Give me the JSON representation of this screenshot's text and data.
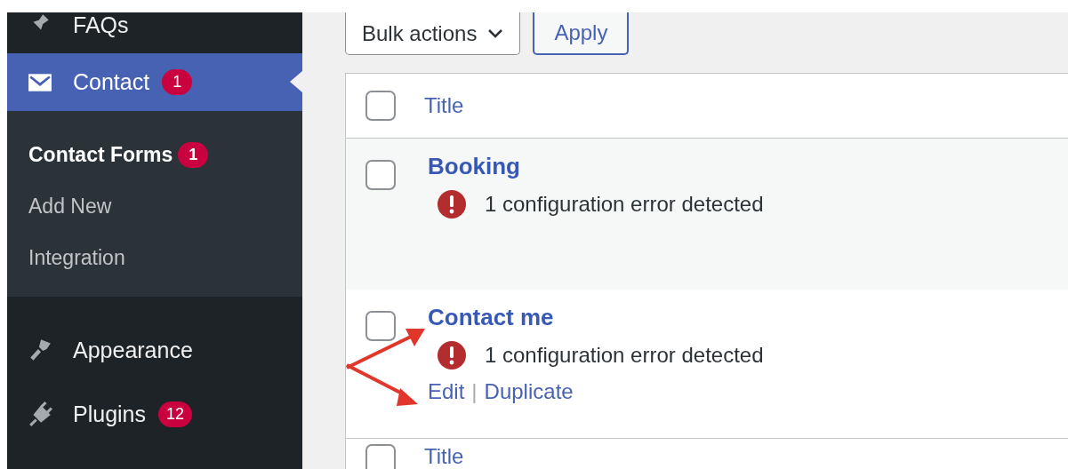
{
  "sidebar": {
    "items": [
      {
        "label": "FAQs",
        "selected": false
      },
      {
        "label": "Contact",
        "selected": true,
        "badge": "1",
        "submenu": [
          {
            "label": "Contact Forms",
            "selected": true,
            "badge": "1"
          },
          {
            "label": "Add New",
            "selected": false
          },
          {
            "label": "Integration",
            "selected": false
          }
        ]
      },
      {
        "label": "Appearance",
        "selected": false
      },
      {
        "label": "Plugins",
        "selected": false,
        "badge": "12"
      }
    ]
  },
  "toolbar": {
    "bulk_actions": "Bulk actions",
    "apply": "Apply"
  },
  "table": {
    "header": {
      "label": "Title",
      "checked": false
    },
    "rows": [
      {
        "title": "Booking",
        "error": "1 configuration error detected",
        "checked": false,
        "actions": []
      },
      {
        "title": "Contact me",
        "error": "1 configuration error detected",
        "checked": false,
        "actions": [
          "Edit",
          "Duplicate"
        ],
        "separator": "|"
      }
    ],
    "footer": {
      "label": "Title",
      "checked": false
    }
  }
}
